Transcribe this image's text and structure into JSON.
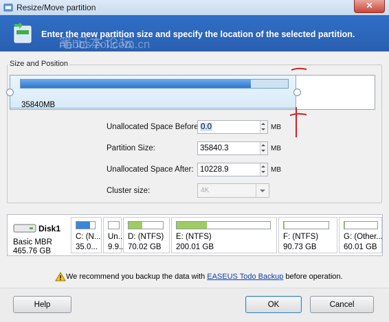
{
  "window": {
    "title": "Resize/Move partition",
    "close_label": "✕"
  },
  "banner": {
    "text": "Enter the new partition size and specify the location of the selected partition.",
    "watermark_line1": "笔记本论坛",
    "watermark_line2": "nbbbs.zol.com.cn"
  },
  "size_position": {
    "group_label": "Size and Position",
    "partition_size_label": "35840MB",
    "fill_fraction": 0.86
  },
  "fields": {
    "unalloc_before": {
      "label": "Unallocated Space Before:",
      "value": "0.0",
      "unit": "MB"
    },
    "partition_size": {
      "label": "Partition Size:",
      "value": "35840.3",
      "unit": "MB"
    },
    "unalloc_after": {
      "label": "Unallocated Space After:",
      "value": "10228.9",
      "unit": "MB"
    },
    "cluster_size": {
      "label": "Cluster size:",
      "value": "4K"
    }
  },
  "disk": {
    "name": "Disk1",
    "type": "Basic MBR",
    "size": "465.76 GB",
    "partitions": [
      {
        "name": "C: (N...",
        "size": "35.0...",
        "fill": 0.75,
        "color": "#3b86d8"
      },
      {
        "name": "Un...",
        "size": "9.9...",
        "fill": 0,
        "color": "#ffffff"
      },
      {
        "name": "D: (NTFS)",
        "size": "70.02 GB",
        "fill": 0.4,
        "color": "#9fcb63"
      },
      {
        "name": "E: (NTFS)",
        "size": "200.01 GB",
        "fill": 0.32,
        "color": "#9fcb63"
      },
      {
        "name": "F: (NTFS)",
        "size": "90.73 GB",
        "fill": 0.02,
        "color": "#9fcb63"
      },
      {
        "name": "G: (Other...",
        "size": "60.01 GB",
        "fill": 0.02,
        "color": "#9fcb63"
      }
    ]
  },
  "warning": {
    "prefix": "We recommend you backup the data with ",
    "link": "EASEUS Todo Backup",
    "suffix": " before operation."
  },
  "buttons": {
    "help": "Help",
    "ok": "OK",
    "cancel": "Cancel"
  }
}
